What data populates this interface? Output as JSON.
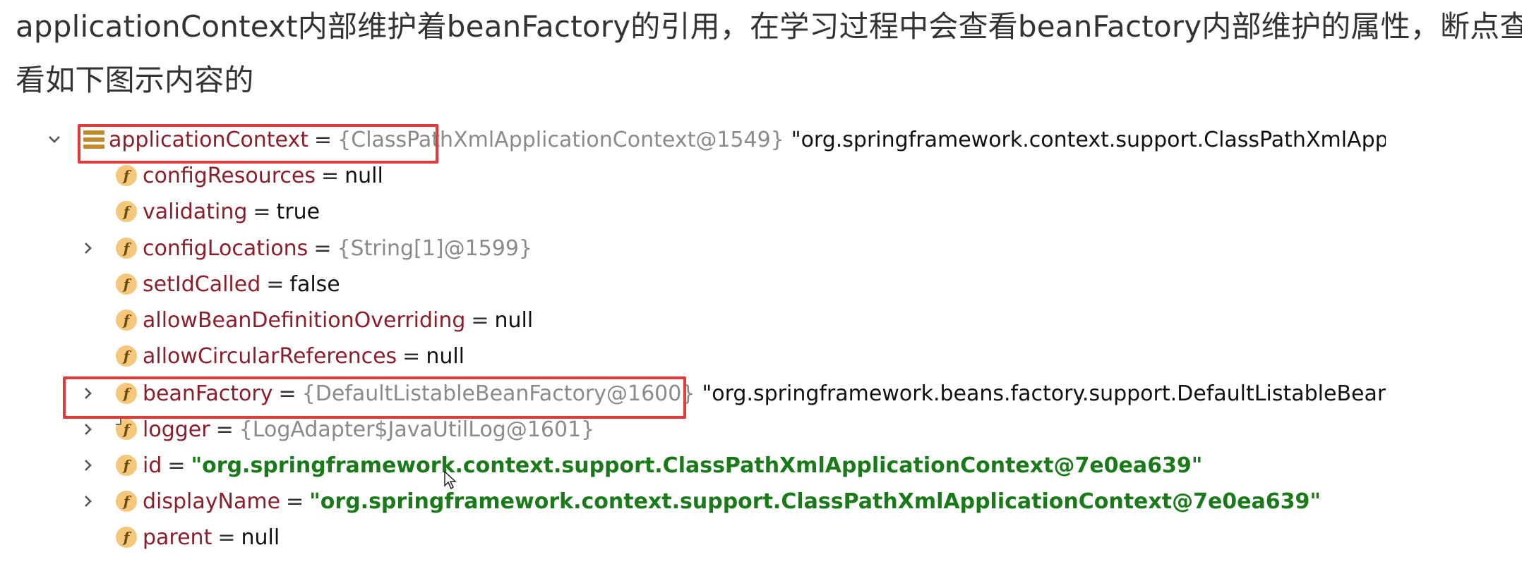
{
  "intro": {
    "line1": "applicationContext内部维护着beanFactory的引用，在学习过程中会查看beanFactory内部维护的属性，断点查",
    "line2": "看如下图示内容的"
  },
  "tree": {
    "root": {
      "name": "applicationContext",
      "eq": "=",
      "object": "{ClassPathXmlApplicationContext@1549}",
      "description": "\"org.springframework.context.support.ClassPathXmlApplication("
    },
    "fields": [
      {
        "name": "configResources",
        "eq": "=",
        "value": "null"
      },
      {
        "name": "validating",
        "eq": "=",
        "value": "true"
      },
      {
        "name": "configLocations",
        "eq": "=",
        "value": "{String[1]@1599}"
      },
      {
        "name": "setIdCalled",
        "eq": "=",
        "value": "false"
      },
      {
        "name": "allowBeanDefinitionOverriding",
        "eq": "=",
        "value": "null"
      },
      {
        "name": "allowCircularReferences",
        "eq": "=",
        "value": "null"
      },
      {
        "name": "beanFactory",
        "eq": "=",
        "value": "{DefaultListableBeanFactory@1600}",
        "description": "\"org.springframework.beans.factory.support.DefaultListableBeanFactory@"
      },
      {
        "name": "logger",
        "eq": "=",
        "value": "{LogAdapter$JavaUtilLog@1601}"
      },
      {
        "name": "id",
        "eq": "=",
        "value": "\"org.springframework.context.support.ClassPathXmlApplicationContext@7e0ea639\""
      },
      {
        "name": "displayName",
        "eq": "=",
        "value": "\"org.springframework.context.support.ClassPathXmlApplicationContext@7e0ea639\""
      },
      {
        "name": "parent",
        "eq": "=",
        "value": "null"
      }
    ],
    "field_icon_letter": "f"
  },
  "colors": {
    "highlight": "#e23a3a",
    "field_name": "#8a1e2a",
    "string_value": "#1a7a1a",
    "object_ref": "#8a8a8a",
    "field_icon_bg": "#f4c77b"
  },
  "icons": {
    "root": "object-stack-icon",
    "field": "field-f-icon",
    "expand": "chevron-right-icon",
    "collapse": "chevron-down-icon"
  }
}
